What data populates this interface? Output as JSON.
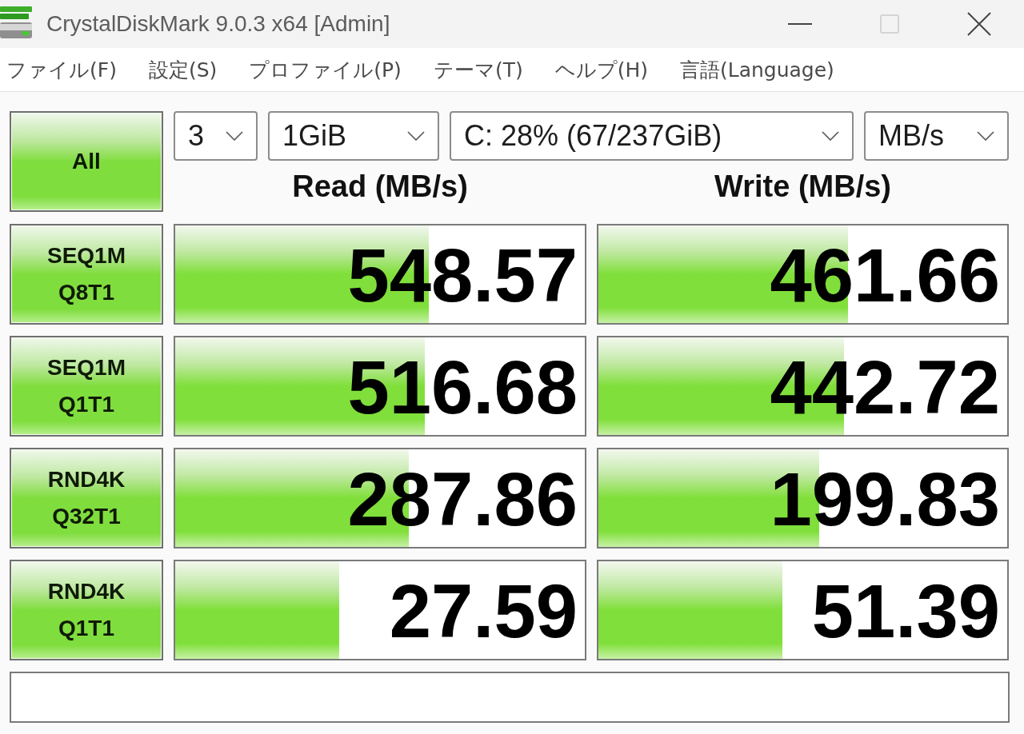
{
  "window": {
    "title": "CrystalDiskMark 9.0.3 x64 [Admin]"
  },
  "window_controls": [
    {
      "kind": "minimize",
      "disabled": false
    },
    {
      "kind": "maximize",
      "disabled": true
    },
    {
      "kind": "close",
      "disabled": false
    }
  ],
  "menu": [
    {
      "label": "ファイル(F)"
    },
    {
      "label": "設定(S)"
    },
    {
      "label": "プロファイル(P)"
    },
    {
      "label": "テーマ(T)"
    },
    {
      "label": "ヘルプ(H)"
    },
    {
      "label": "言語(Language)"
    }
  ],
  "all_button": {
    "label": "All"
  },
  "dropdowns": [
    {
      "value": "3"
    },
    {
      "value": "1GiB"
    },
    {
      "value": "C: 28% (67/237GiB)"
    },
    {
      "value": "MB/s"
    }
  ],
  "columns": [
    "Read (MB/s)",
    "Write (MB/s)"
  ],
  "rows": [
    {
      "test": [
        "SEQ1M",
        "Q8T1"
      ],
      "read": {
        "value": "548.57",
        "level": 0.62
      },
      "write": {
        "value": "461.66",
        "level": 0.61
      }
    },
    {
      "test": [
        "SEQ1M",
        "Q1T1"
      ],
      "read": {
        "value": "516.68",
        "level": 0.61
      },
      "write": {
        "value": "442.72",
        "level": 0.6
      }
    },
    {
      "test": [
        "RND4K",
        "Q32T1"
      ],
      "read": {
        "value": "287.86",
        "level": 0.57
      },
      "write": {
        "value": "199.83",
        "level": 0.54
      }
    },
    {
      "test": [
        "RND4K",
        "Q1T1"
      ],
      "read": {
        "value": "27.59",
        "level": 0.4
      },
      "write": {
        "value": "51.39",
        "level": 0.45
      }
    }
  ]
}
